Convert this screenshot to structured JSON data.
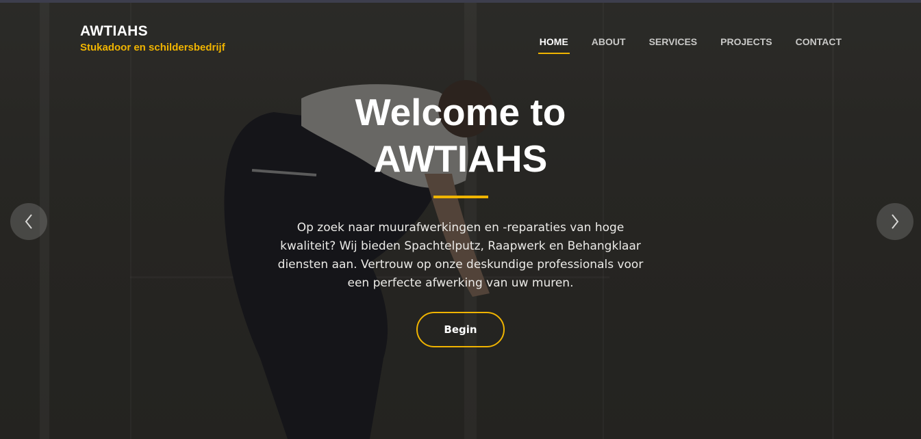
{
  "brand": {
    "name": "AWTIAHS",
    "tagline": "Stukadoor en schildersbedrijf"
  },
  "nav": {
    "items": [
      {
        "label": "HOME",
        "active": true
      },
      {
        "label": "ABOUT",
        "active": false
      },
      {
        "label": "SERVICES",
        "active": false
      },
      {
        "label": "PROJECTS",
        "active": false
      },
      {
        "label": "CONTACT",
        "active": false
      }
    ]
  },
  "hero": {
    "title_line1": "Welcome to",
    "title_line2": "AWTIAHS",
    "description": "Op zoek naar muurafwerkingen en -reparaties van hoge kwaliteit? Wij bieden Spachtelputz, Raapwerk en Behangklaar diensten aan. Vertrouw op onze deskundige professionals voor een perfecte afwerking van uw muren.",
    "cta_label": "Begin"
  },
  "carousel": {
    "prev_icon": "chevron-left-icon",
    "next_icon": "chevron-right-icon"
  },
  "colors": {
    "accent": "#f0b400",
    "overlay": "#2f2e2b"
  }
}
